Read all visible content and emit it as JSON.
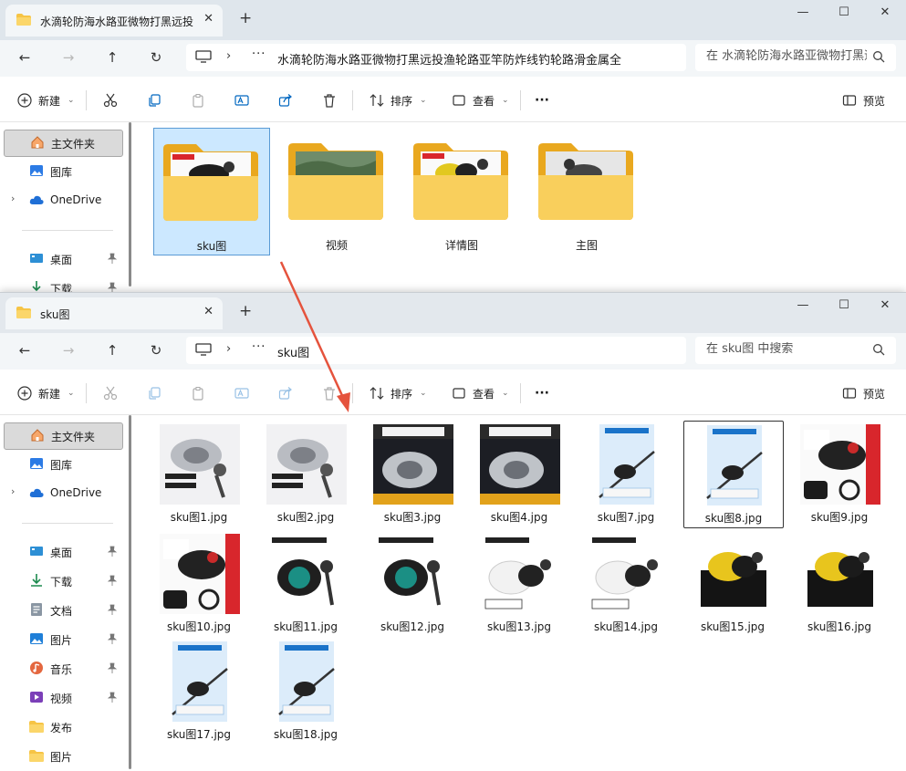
{
  "window_back": {
    "tab_title": "水滴轮防海水路亚微物打黑远投渔轮路亚竿防炸线钓轮路滑金属全",
    "address_path": "水滴轮防海水路亚微物打黑远投渔轮路亚竿防炸线钓轮路滑金属全",
    "search_placeholder": "在 水滴轮防海水路亚微物打黑远投渔轮路亚竿防炸线钓轮路滑金属全 中搜索",
    "folders": [
      {
        "label": "sku图",
        "selected": true,
        "preview": "reel-dark"
      },
      {
        "label": "视频",
        "selected": false,
        "preview": "landscape"
      },
      {
        "label": "详情图",
        "selected": false,
        "preview": "reel-yellow"
      },
      {
        "label": "主图",
        "selected": false,
        "preview": "reel-grey"
      }
    ],
    "sidebar": [
      {
        "label": "主文件夹",
        "icon": "home-icon",
        "selected": true
      },
      {
        "label": "图库",
        "icon": "gallery-icon"
      },
      {
        "label": "OneDrive",
        "icon": "cloud-icon",
        "expandable": true
      },
      {
        "label": "桌面",
        "icon": "desktop-icon",
        "pinned": true
      },
      {
        "label": "下载",
        "icon": "download-icon",
        "pinned": true
      }
    ]
  },
  "window_front": {
    "tab_title": "sku图",
    "address_path": "sku图",
    "search_placeholder": "在 sku图 中搜索",
    "sidebar": [
      {
        "label": "主文件夹",
        "icon": "home-icon",
        "selected": true
      },
      {
        "label": "图库",
        "icon": "gallery-icon"
      },
      {
        "label": "OneDrive",
        "icon": "cloud-icon",
        "expandable": true
      },
      {
        "label": "桌面",
        "icon": "desktop-icon",
        "pinned": true
      },
      {
        "label": "下载",
        "icon": "download-icon",
        "pinned": true
      },
      {
        "label": "文档",
        "icon": "document-icon",
        "pinned": true
      },
      {
        "label": "图片",
        "icon": "pictures-icon",
        "pinned": true
      },
      {
        "label": "音乐",
        "icon": "music-icon",
        "pinned": true
      },
      {
        "label": "视频",
        "icon": "video-icon",
        "pinned": true
      },
      {
        "label": "发布",
        "icon": "folder-icon"
      },
      {
        "label": "图片",
        "icon": "folder-icon"
      }
    ],
    "files": [
      {
        "name": "sku图1.jpg",
        "style": "silver"
      },
      {
        "name": "sku图2.jpg",
        "style": "silver"
      },
      {
        "name": "sku图3.jpg",
        "style": "dark"
      },
      {
        "name": "sku图4.jpg",
        "style": "dark"
      },
      {
        "name": "sku图7.jpg",
        "style": "rod"
      },
      {
        "name": "sku图8.jpg",
        "style": "rod",
        "selected": true
      },
      {
        "name": "sku图9.jpg",
        "style": "red"
      },
      {
        "name": "sku图10.jpg",
        "style": "red"
      },
      {
        "name": "sku图11.jpg",
        "style": "green"
      },
      {
        "name": "sku图12.jpg",
        "style": "green"
      },
      {
        "name": "sku图13.jpg",
        "style": "white"
      },
      {
        "name": "sku图14.jpg",
        "style": "white"
      },
      {
        "name": "sku图15.jpg",
        "style": "yellow"
      },
      {
        "name": "sku图16.jpg",
        "style": "yellow"
      },
      {
        "name": "sku图17.jpg",
        "style": "rod"
      },
      {
        "name": "sku图18.jpg",
        "style": "rod"
      }
    ]
  },
  "toolbar": {
    "new_label": "新建",
    "sort_label": "排序",
    "view_label": "查看",
    "more_label": "···",
    "preview_label": "预览"
  },
  "colors": {
    "accent": "#0067c0",
    "folder": "#f6c445",
    "selection_bg": "#cce8ff",
    "arrow": "#e5533d"
  }
}
